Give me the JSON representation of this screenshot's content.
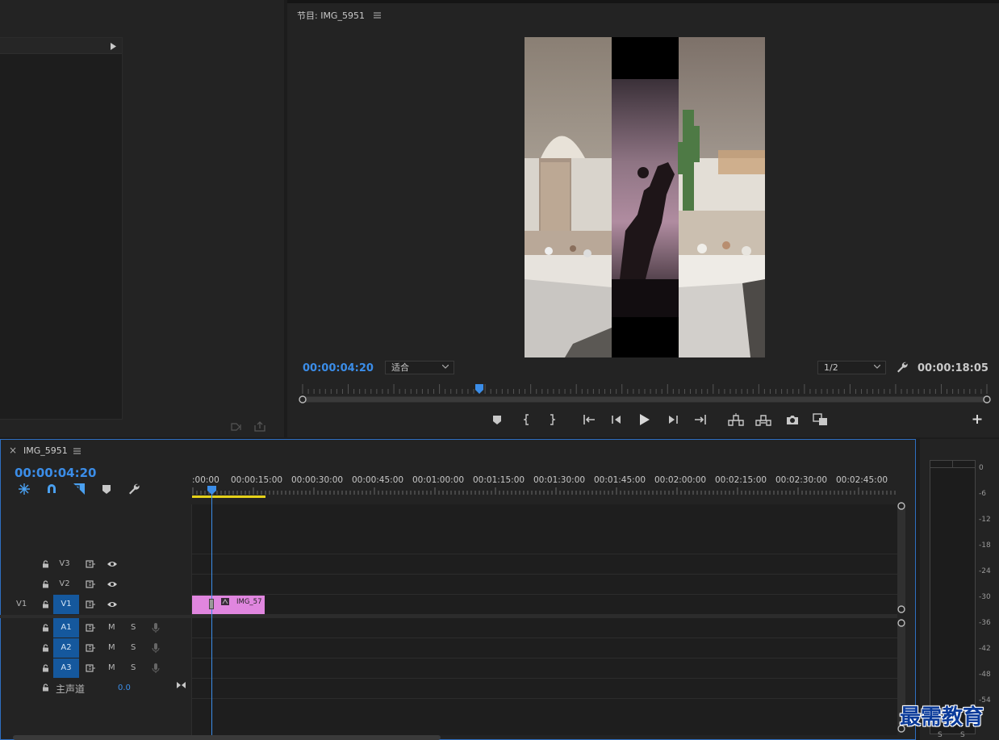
{
  "program": {
    "title": "节目: IMG_5951",
    "menu_icon": "hamburger-icon",
    "timecode_current": "00:00:04:20",
    "zoom": "适合",
    "resolution": "1/2",
    "timecode_duration": "00:00:18:05",
    "playhead_fraction": 0.258
  },
  "timeline": {
    "close": "×",
    "sequence_name": "IMG_5951",
    "timecode": "00:00:04:20",
    "ruler": [
      ":00:00",
      "00:00:15:00",
      "00:00:30:00",
      "00:00:45:00",
      "00:01:00:00",
      "00:01:15:00",
      "00:01:30:00",
      "00:01:45:00",
      "00:02:00:00",
      "00:02:15:00",
      "00:02:30:00",
      "00:02:45:00"
    ],
    "video_tracks": [
      {
        "source": "",
        "name": "V3",
        "targeted": false
      },
      {
        "source": "",
        "name": "V2",
        "targeted": false
      },
      {
        "source": "V1",
        "name": "V1",
        "targeted": true
      }
    ],
    "audio_tracks": [
      {
        "name": "A1",
        "m": "M",
        "s": "S"
      },
      {
        "name": "A2",
        "m": "M",
        "s": "S"
      },
      {
        "name": "A3",
        "m": "M",
        "s": "S"
      }
    ],
    "master": {
      "label": "主声道",
      "value": "0.0"
    },
    "clip": {
      "label": "IMG_57",
      "color": "#e086df"
    }
  },
  "meter": {
    "scale": [
      "0",
      "-6",
      "-12",
      "-18",
      "-24",
      "-30",
      "-36",
      "-42",
      "-48",
      "-54"
    ],
    "solo_labels": [
      "S",
      "S"
    ]
  },
  "watermark": "最需教育",
  "colors": {
    "accent": "#3b8de8",
    "target": "#15589d",
    "clip": "#e086df",
    "work_area": "#e6d21a"
  }
}
